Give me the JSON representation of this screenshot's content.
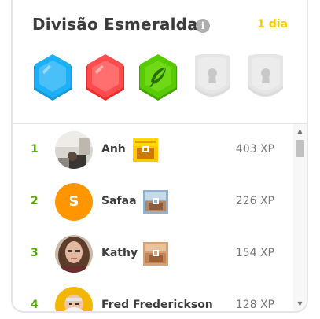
{
  "header": {
    "title": "Divisão Esmeralda",
    "time_left": "1 dia",
    "info_icon": "info-icon"
  },
  "badges": [
    {
      "name": "sapphire-league-badge",
      "color": "#1cb0f6",
      "state": "unlocked"
    },
    {
      "name": "ruby-league-badge",
      "color": "#ff4b4b",
      "state": "unlocked"
    },
    {
      "name": "emerald-league-badge",
      "color": "#58cc02",
      "state": "current",
      "icon": "feather-icon"
    },
    {
      "name": "locked-league-badge",
      "color": "#e5e5e5",
      "state": "locked",
      "icon": "lock-icon"
    },
    {
      "name": "locked-league-badge",
      "color": "#e5e5e5",
      "state": "locked",
      "icon": "lock-icon"
    }
  ],
  "leaderboard": [
    {
      "rank": "1",
      "name": "Anh",
      "xp": "403 XP",
      "avatar": "photo",
      "chest": "gold"
    },
    {
      "rank": "2",
      "name": "Safaa",
      "xp": "226 XP",
      "avatar": "letter",
      "avatar_letter": "S",
      "avatar_color": "#ff9600",
      "chest": "silver"
    },
    {
      "rank": "3",
      "name": "Kathy",
      "xp": "154 XP",
      "avatar": "photo",
      "chest": "bronze"
    },
    {
      "rank": "4",
      "name": "Fred Frederickson",
      "xp": "128 XP",
      "avatar": "photo"
    }
  ],
  "colors": {
    "rank_green": "#58a700",
    "days_yellow": "#ffc800",
    "text_dark": "#3c3c3c",
    "text_gray": "#777777"
  }
}
